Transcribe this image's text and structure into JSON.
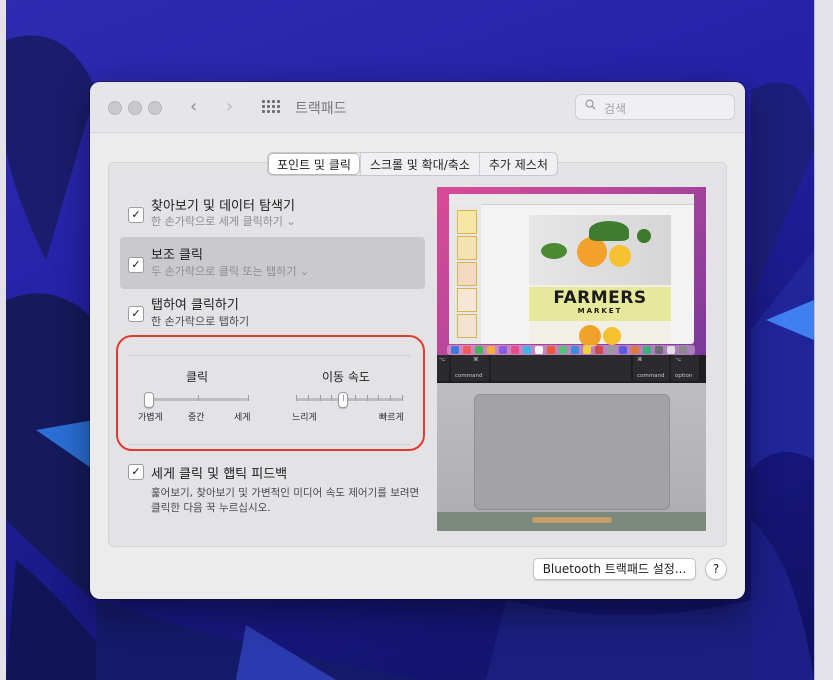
{
  "window": {
    "title": "트랙패드",
    "search_placeholder": "검색",
    "nav_back": "‹",
    "nav_forward": "›"
  },
  "tabs": [
    {
      "label": "포인트 및 클릭",
      "active": true
    },
    {
      "label": "스크롤 및 확대/축소",
      "active": false
    },
    {
      "label": "추가 제스처",
      "active": false
    }
  ],
  "options": [
    {
      "title": "찾아보기 및 데이터 탐색기",
      "subtitle": "한 손가락으로 세게 클릭하기 ⌄",
      "checked": true
    },
    {
      "title": "보조 클릭",
      "subtitle": "두 손가락으로 클릭 또는 탭하기 ⌄",
      "checked": true
    },
    {
      "title": "탭하여 클릭하기",
      "subtitle": "한 손가락으로 탭하기",
      "checked": true
    }
  ],
  "click_slider": {
    "label": "클릭",
    "ticks": [
      "가볍게",
      "중간",
      "세게"
    ],
    "value_index": 0
  },
  "tracking_slider": {
    "label": "이동 속도",
    "min_label": "느리게",
    "max_label": "빠르게",
    "value": 0.43
  },
  "force_click": {
    "title": "세게 클릭 및 햅틱 피드백",
    "description_line1": "훑어보기, 찾아보기 및 가변적인 미디어 속도 제어기를 보려면",
    "description_line2": "클릭한 다음 꾹 누르십시오.",
    "checked": true
  },
  "preview": {
    "poster_title": "FARMERS",
    "poster_subtitle": "MARKET",
    "key_left_symbol": "⌥",
    "key_left_label": "command",
    "key_left_symbol2": "⌘",
    "key_right_symbol": "⌘",
    "key_right_label": "command",
    "key_right_symbol2": "⌥",
    "key_right_label2": "option"
  },
  "buttons": {
    "bluetooth": "Bluetooth 트랙패드 설정...",
    "help": "?"
  },
  "colors": {
    "accent_check": "#1d1d1f",
    "annotation": "#e23a2f",
    "desktop": "#2522a8"
  }
}
